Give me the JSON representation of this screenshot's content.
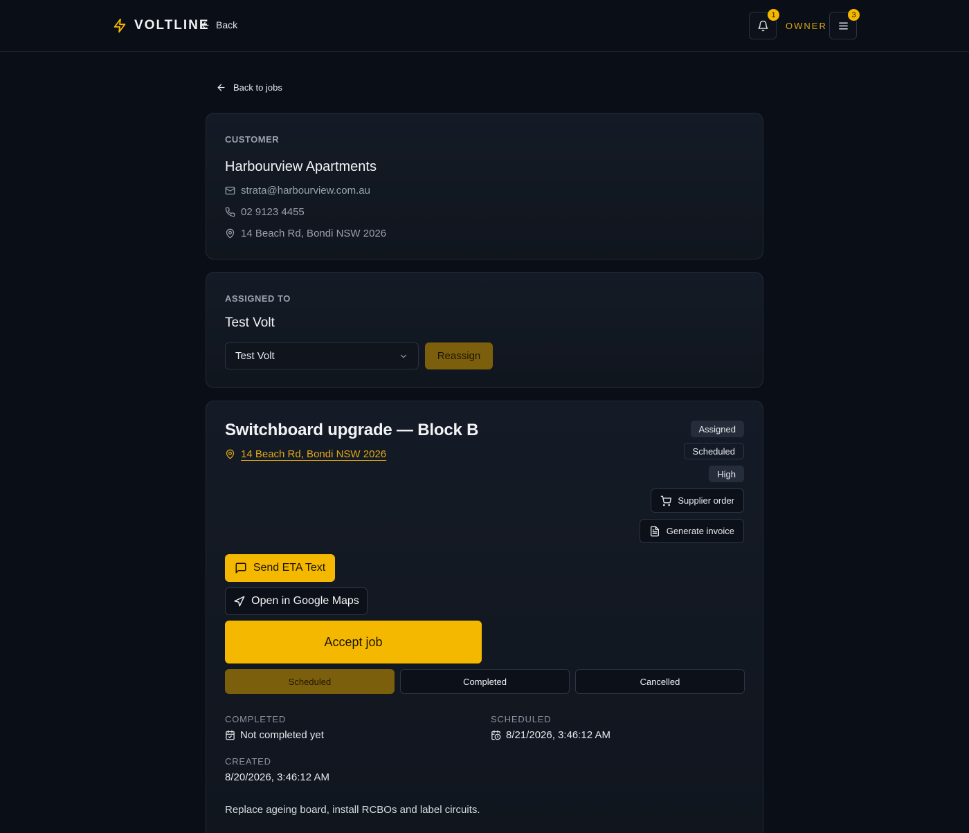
{
  "header": {
    "brand": "VOLTLINE",
    "back_label": "Back",
    "role": "OWNER",
    "notifications_count": "1",
    "menu_count": "3",
    "brand_color": "#f5b800"
  },
  "nav": {
    "back_to_jobs": "Back to jobs"
  },
  "customer": {
    "section_label": "CUSTOMER",
    "name": "Harbourview Apartments",
    "email": "strata@harbourview.com.au",
    "phone": "02 9123 4455",
    "address": "14 Beach Rd, Bondi NSW 2026"
  },
  "assignment": {
    "section_label": "ASSIGNED TO",
    "assignee": "Test Volt",
    "select_value": "Test Volt",
    "reassign_label": "Reassign"
  },
  "job": {
    "title": "Switchboard upgrade — Block B",
    "address": "14 Beach Rd, Bondi NSW 2026",
    "badges": [
      "Assigned",
      "Scheduled",
      "High"
    ],
    "supplier_order_label": "Supplier order",
    "generate_invoice_label": "Generate invoice",
    "send_eta_label": "Send ETA Text",
    "maps_label": "Open in Google Maps",
    "accept_label": "Accept job",
    "status_options": [
      "Scheduled",
      "Completed",
      "Cancelled"
    ],
    "active_status": "Scheduled",
    "completed_label": "COMPLETED",
    "completed_value": "Not completed yet",
    "scheduled_label": "SCHEDULED",
    "scheduled_value": "8/21/2026, 3:46:12 AM",
    "created_label": "CREATED",
    "created_value": "8/20/2026, 3:46:12 AM",
    "description": "Replace ageing board, install RCBOs and label circuits."
  }
}
